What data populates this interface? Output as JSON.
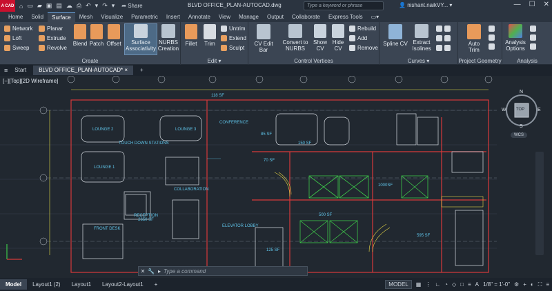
{
  "titlebar": {
    "app_label": "A CAD",
    "share": "Share",
    "doc_title": "BLVD OFFICE_PLAN-AUTOCAD.dwg",
    "search_placeholder": "Type a keyword or phrase",
    "user": "nishant.naikVY...",
    "minimize": "—",
    "maximize": "☐",
    "close": "✕"
  },
  "menu_tabs": [
    "Home",
    "Solid",
    "Surface",
    "Mesh",
    "Visualize",
    "Parametric",
    "Insert",
    "Annotate",
    "View",
    "Manage",
    "Output",
    "Collaborate",
    "Express Tools"
  ],
  "active_tab": "Surface",
  "ribbon": {
    "create": {
      "title": "Create",
      "network": "Network",
      "loft": "Loft",
      "sweep": "Sweep",
      "planar": "Planar",
      "extrude": "Extrude",
      "revolve": "Revolve",
      "blend": "Blend",
      "patch": "Patch",
      "offset": "Offset",
      "surface_assoc_1": "Surface",
      "surface_assoc_2": "Associativity",
      "nurbs_1": "NURBS",
      "nurbs_2": "Creation"
    },
    "edit": {
      "title": "Edit ▾",
      "fillet": "Fillet",
      "trim": "Trim",
      "untrim": "Untrim",
      "extend": "Extend",
      "sculpt": "Sculpt"
    },
    "control_vertices": {
      "title": "Control Vertices",
      "cv_edit_bar": "CV Edit Bar",
      "convert_1": "Convert to",
      "convert_2": "NURBS",
      "show_1": "Show",
      "show_2": "CV",
      "hide_1": "Hide",
      "hide_2": "CV",
      "rebuild": "Rebuild",
      "add": "Add",
      "remove": "Remove"
    },
    "curves": {
      "title": "Curves ▾",
      "spline_cv": "Spline CV",
      "extract_1": "Extract",
      "extract_2": "Isolines"
    },
    "project_geometry": {
      "title": "Project Geometry",
      "auto_1": "Auto",
      "auto_2": "Trim"
    },
    "analysis": {
      "title": "Analysis",
      "analysis_1": "Analysis",
      "analysis_2": "Options"
    }
  },
  "file_tabs": {
    "start": "Start",
    "active": "BLVD OFFICE_PLAN-AUTOCAD*",
    "close": "×",
    "add": "+"
  },
  "viewport": {
    "label": "[−][Top][2D Wireframe]",
    "cube_top": "TOP",
    "n": "N",
    "s": "S",
    "e": "E",
    "w": "W",
    "wcs": "WCS"
  },
  "plan_labels": {
    "lounge2": "LOUNGE 2",
    "lounge3": "LOUNGE 3",
    "conference": "CONFERENCE",
    "touchdown": "TOUCH DOWN STATIONS",
    "lounge1": "LOUNGE 1",
    "collaboration": "COLLABORATION",
    "reception_1": "RECEPTION",
    "reception_2": "2650 SF",
    "front_desk": "FRONT DESK",
    "elevator_lobby": "ELEVATOR LOBBY",
    "sf118": "118 SF",
    "sf70": "70 SF",
    "sf500": "500 SF",
    "sf1000": "1000SF",
    "sf595": "595 SF",
    "sf125": "125 SF",
    "sf85": "85 SF",
    "sf150": "150 SF"
  },
  "command": {
    "placeholder": "Type a command",
    "close": "✕",
    "wrench": "🔧"
  },
  "status": {
    "model": "Model",
    "layout1": "Layout1 (2)",
    "layout2": "Layout1",
    "layout3": "Layout2-Layout1",
    "add": "+",
    "model_badge": "MODEL",
    "scale": "1/8\" = 1'-0\"",
    "menu": "≡"
  }
}
